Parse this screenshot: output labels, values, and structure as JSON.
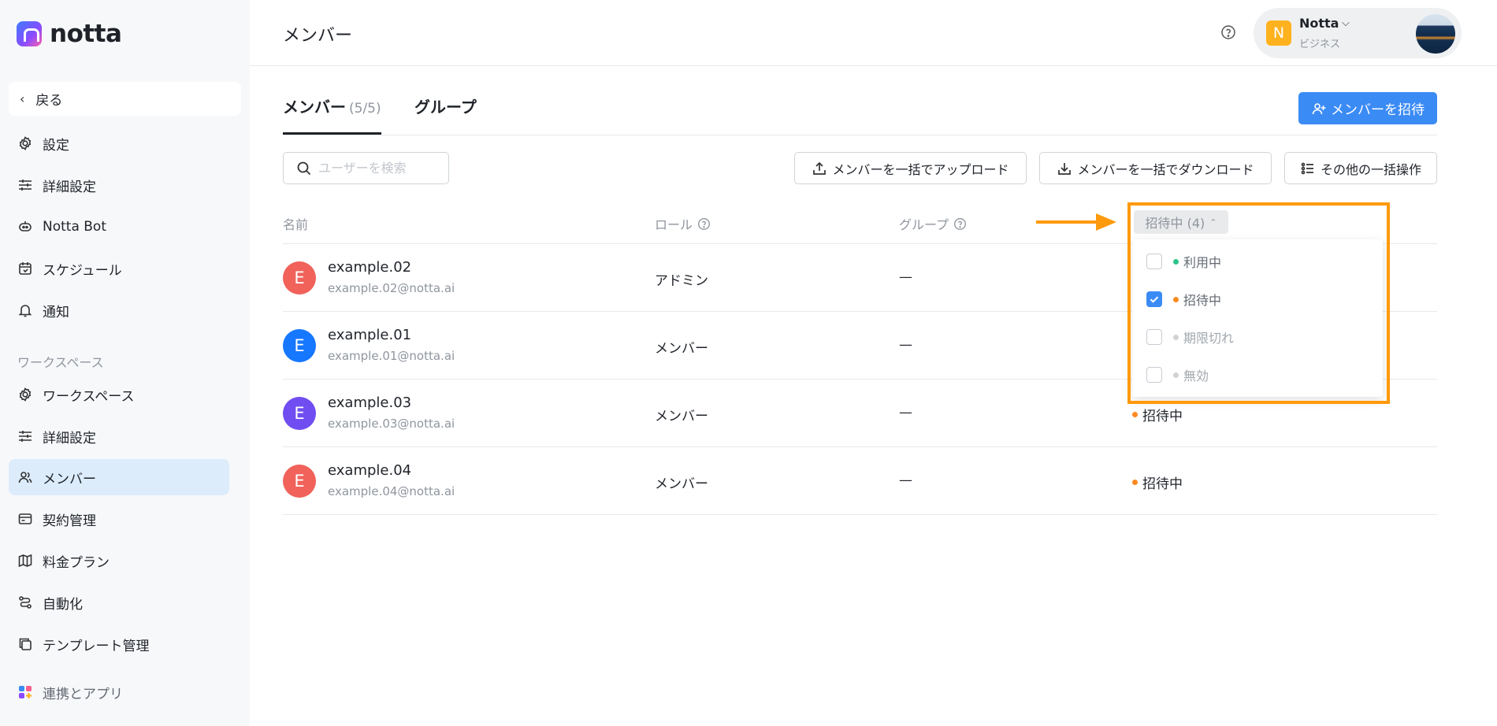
{
  "app": {
    "logo_text": "notta"
  },
  "sidebar": {
    "back_label": "戻る",
    "items_top": [
      {
        "label": "設定",
        "icon": "gear-icon"
      },
      {
        "label": "詳細設定",
        "icon": "sliders-icon"
      },
      {
        "label": "Notta Bot",
        "icon": "bot-icon"
      },
      {
        "label": "スケジュール",
        "icon": "calendar-icon"
      },
      {
        "label": "通知",
        "icon": "bell-icon"
      }
    ],
    "section_label": "ワークスペース",
    "items_ws": [
      {
        "label": "ワークスペース",
        "icon": "gear-icon"
      },
      {
        "label": "詳細設定",
        "icon": "sliders-icon"
      },
      {
        "label": "メンバー",
        "icon": "users-icon",
        "active": true
      },
      {
        "label": "契約管理",
        "icon": "card-icon"
      },
      {
        "label": "料金プラン",
        "icon": "map-icon"
      },
      {
        "label": "自動化",
        "icon": "flow-icon"
      },
      {
        "label": "テンプレート管理",
        "icon": "template-icon"
      }
    ],
    "integrations_label": "連携とアプリ"
  },
  "header": {
    "title": "メンバー",
    "account": {
      "initial": "N",
      "name": "Notta",
      "plan": "ビジネス"
    }
  },
  "tabs": [
    {
      "label": "メンバー",
      "count": "(5/5)",
      "active": true
    },
    {
      "label": "グループ",
      "count": ""
    }
  ],
  "toolbar": {
    "invite_label": "メンバーを招待",
    "search_placeholder": "ユーザーを検索",
    "bulk_upload_label": "メンバーを一括でアップロード",
    "bulk_download_label": "メンバーを一括でダウンロード",
    "other_bulk_label": "その他の一括操作"
  },
  "table": {
    "columns": {
      "name": "名前",
      "role": "ロール",
      "group": "グループ"
    },
    "status_filter": {
      "label": "招待中 (4)",
      "options": [
        {
          "label": "利用中",
          "checked": false,
          "dot": "#2bc48a"
        },
        {
          "label": "招待中",
          "checked": true,
          "dot": "#ff8a1f"
        },
        {
          "label": "期限切れ",
          "checked": false,
          "dot": "#d0d3d6"
        },
        {
          "label": "無効",
          "checked": false,
          "dot": "#d0d3d6"
        }
      ]
    },
    "rows": [
      {
        "initial": "E",
        "name": "example.02",
        "email": "example.02@notta.ai",
        "role": "アドミン",
        "group": "—",
        "status": "",
        "avatar_color": "#f0625a"
      },
      {
        "initial": "E",
        "name": "example.01",
        "email": "example.01@notta.ai",
        "role": "メンバー",
        "group": "—",
        "status": "",
        "avatar_color": "#1677ff"
      },
      {
        "initial": "E",
        "name": "example.03",
        "email": "example.03@notta.ai",
        "role": "メンバー",
        "group": "—",
        "status": "招待中",
        "avatar_color": "#6f4df0"
      },
      {
        "initial": "E",
        "name": "example.04",
        "email": "example.04@notta.ai",
        "role": "メンバー",
        "group": "—",
        "status": "招待中",
        "avatar_color": "#f0625a"
      }
    ]
  },
  "colors": {
    "accent": "#3b8bf5",
    "highlight": "#ff9a0d",
    "status_invited": "#ff8a1f"
  }
}
